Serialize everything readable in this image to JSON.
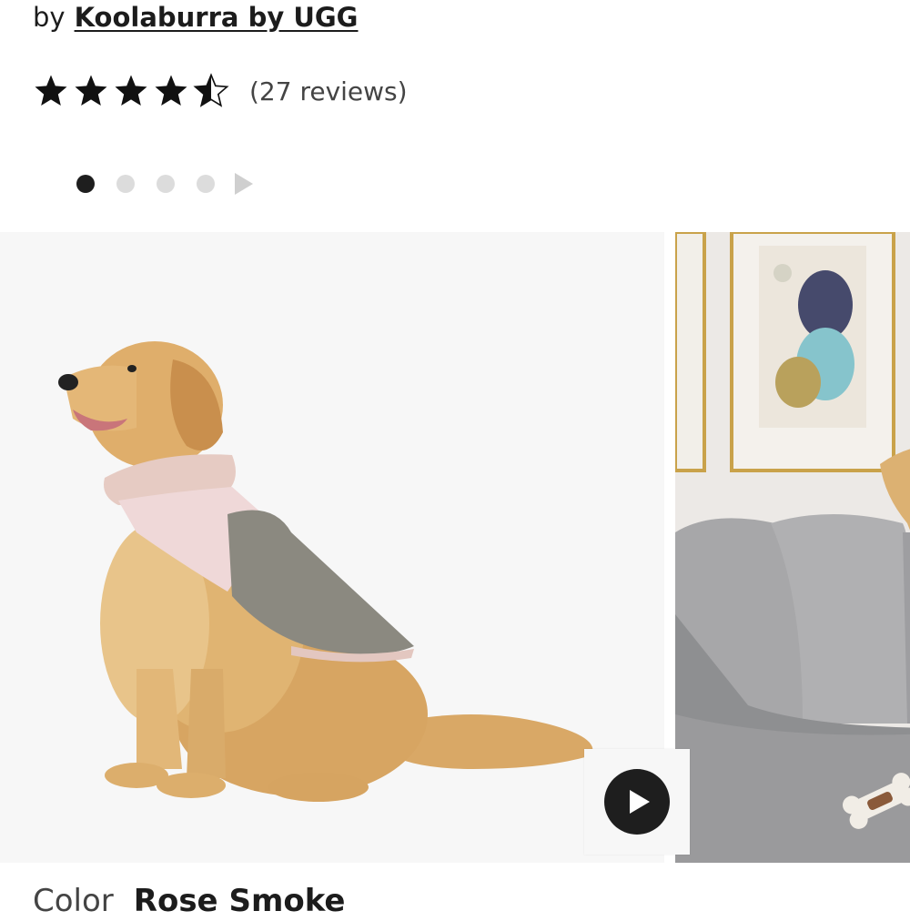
{
  "product": {
    "by_prefix": "by",
    "brand_link": "Koolaburra by UGG",
    "rating_value": 4.5,
    "rating_max": 5,
    "reviews_text": "(27 reviews)"
  },
  "carousel": {
    "slide_count": 4,
    "active_index": 0
  },
  "gallery": {
    "primary_image": "dog-in-rose-smoke-coat-image",
    "secondary_image": "dog-on-sofa-with-blanket-image",
    "video_icon": "play-icon"
  },
  "color": {
    "label": "Color",
    "value": "Rose Smoke"
  },
  "colors": {
    "star": "#111111",
    "accent_dark": "#1e1e1e",
    "dot_inactive": "#dcdcdc"
  }
}
